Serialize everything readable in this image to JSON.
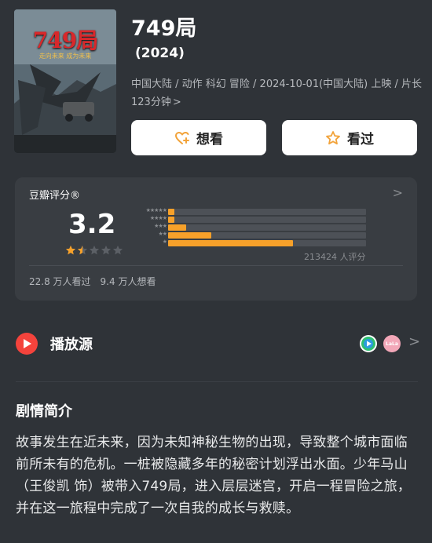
{
  "movie": {
    "poster_title": "749局",
    "poster_tagline": "走向未来 成为未来",
    "title": "749局",
    "year": "(2024)",
    "meta": "中国大陆 / 动作 科幻 冒险 / 2024-10-01(中国大陆) 上映 / 片长123分钟",
    "meta_chevron": ">"
  },
  "actions": {
    "want_label": "想看",
    "seen_label": "看过"
  },
  "rating": {
    "label": "豆瓣评分®",
    "score": "3.2",
    "score_stars_value": 1.5,
    "distribution": [
      {
        "stars": "★★★★★",
        "percent": 3
      },
      {
        "stars": "★★★★",
        "percent": 3
      },
      {
        "stars": "★★★",
        "percent": 9
      },
      {
        "stars": "★★",
        "percent": 22
      },
      {
        "stars": "★",
        "percent": 63
      }
    ],
    "votes": "213424 人评分",
    "watched": "22.8 万人看过",
    "wanted": "9.4 万人想看",
    "chevron": ">"
  },
  "play": {
    "label": "播放源",
    "source2_text": "LaLa",
    "chevron": ">"
  },
  "synopsis": {
    "title": "剧情简介",
    "body": "故事发生在近未来，因为未知神秘生物的出现，导致整个城市面临前所未有的危机。一桩被隐藏多年的秘密计划浮出水面。少年马山（王俊凯 饰）被带入749局，进入层层迷宫，开启一程冒险之旅，并在这一旅程中完成了一次自我的成长与救赎。"
  },
  "colors": {
    "background": "#2f3338",
    "card": "#393d42",
    "accent_bar": "#f7a12a",
    "play_red": "#f4433c"
  }
}
